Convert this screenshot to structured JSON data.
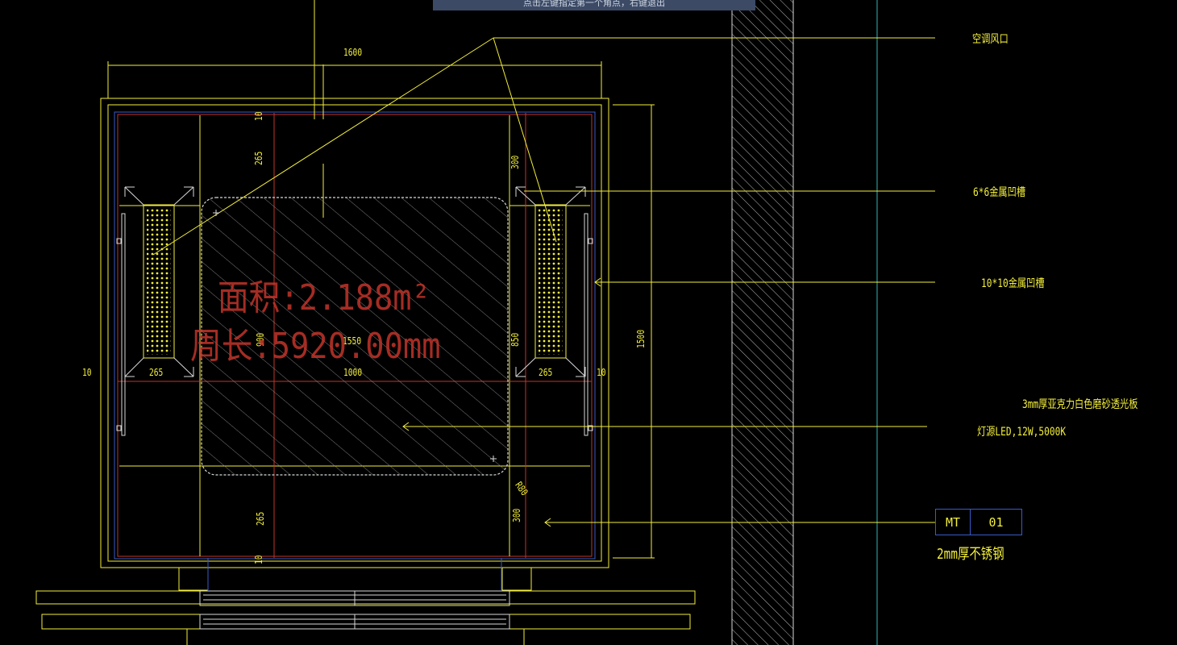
{
  "tooltip": "点击左键指定第一个角点，右键退出",
  "area_text": "面积:2.188m²",
  "perimeter_text": "周长:5920.00mm",
  "callouts": {
    "vent": "空调风口",
    "groove6": "6*6金属凹槽",
    "groove10": "10*10金属凹槽",
    "acrylic": "3mm厚亚克力白色磨砂透光板",
    "led": "灯源LED,12W,5000K",
    "steel": "2mm厚不锈钢"
  },
  "material_tag": {
    "code": "MT",
    "num": "01"
  },
  "dims": {
    "top": "1600",
    "height": "1500",
    "left_edge": "10",
    "right_edge": "10",
    "left_cell": "265",
    "right_cell": "265",
    "center_w": "1000",
    "width_red": "1550",
    "top_gap": "10",
    "v265_top": "265",
    "v265_bot": "265",
    "v300_top": "300",
    "v300_bot": "300",
    "v900": "900",
    "v850": "850",
    "bot_gap": "10",
    "radius": "R80"
  },
  "colors": {
    "line": "#f2ee3a",
    "red": "#c2342a",
    "blue": "#3a5ac8",
    "white": "#d8d8d8",
    "cyan": "#2fb4b4"
  }
}
